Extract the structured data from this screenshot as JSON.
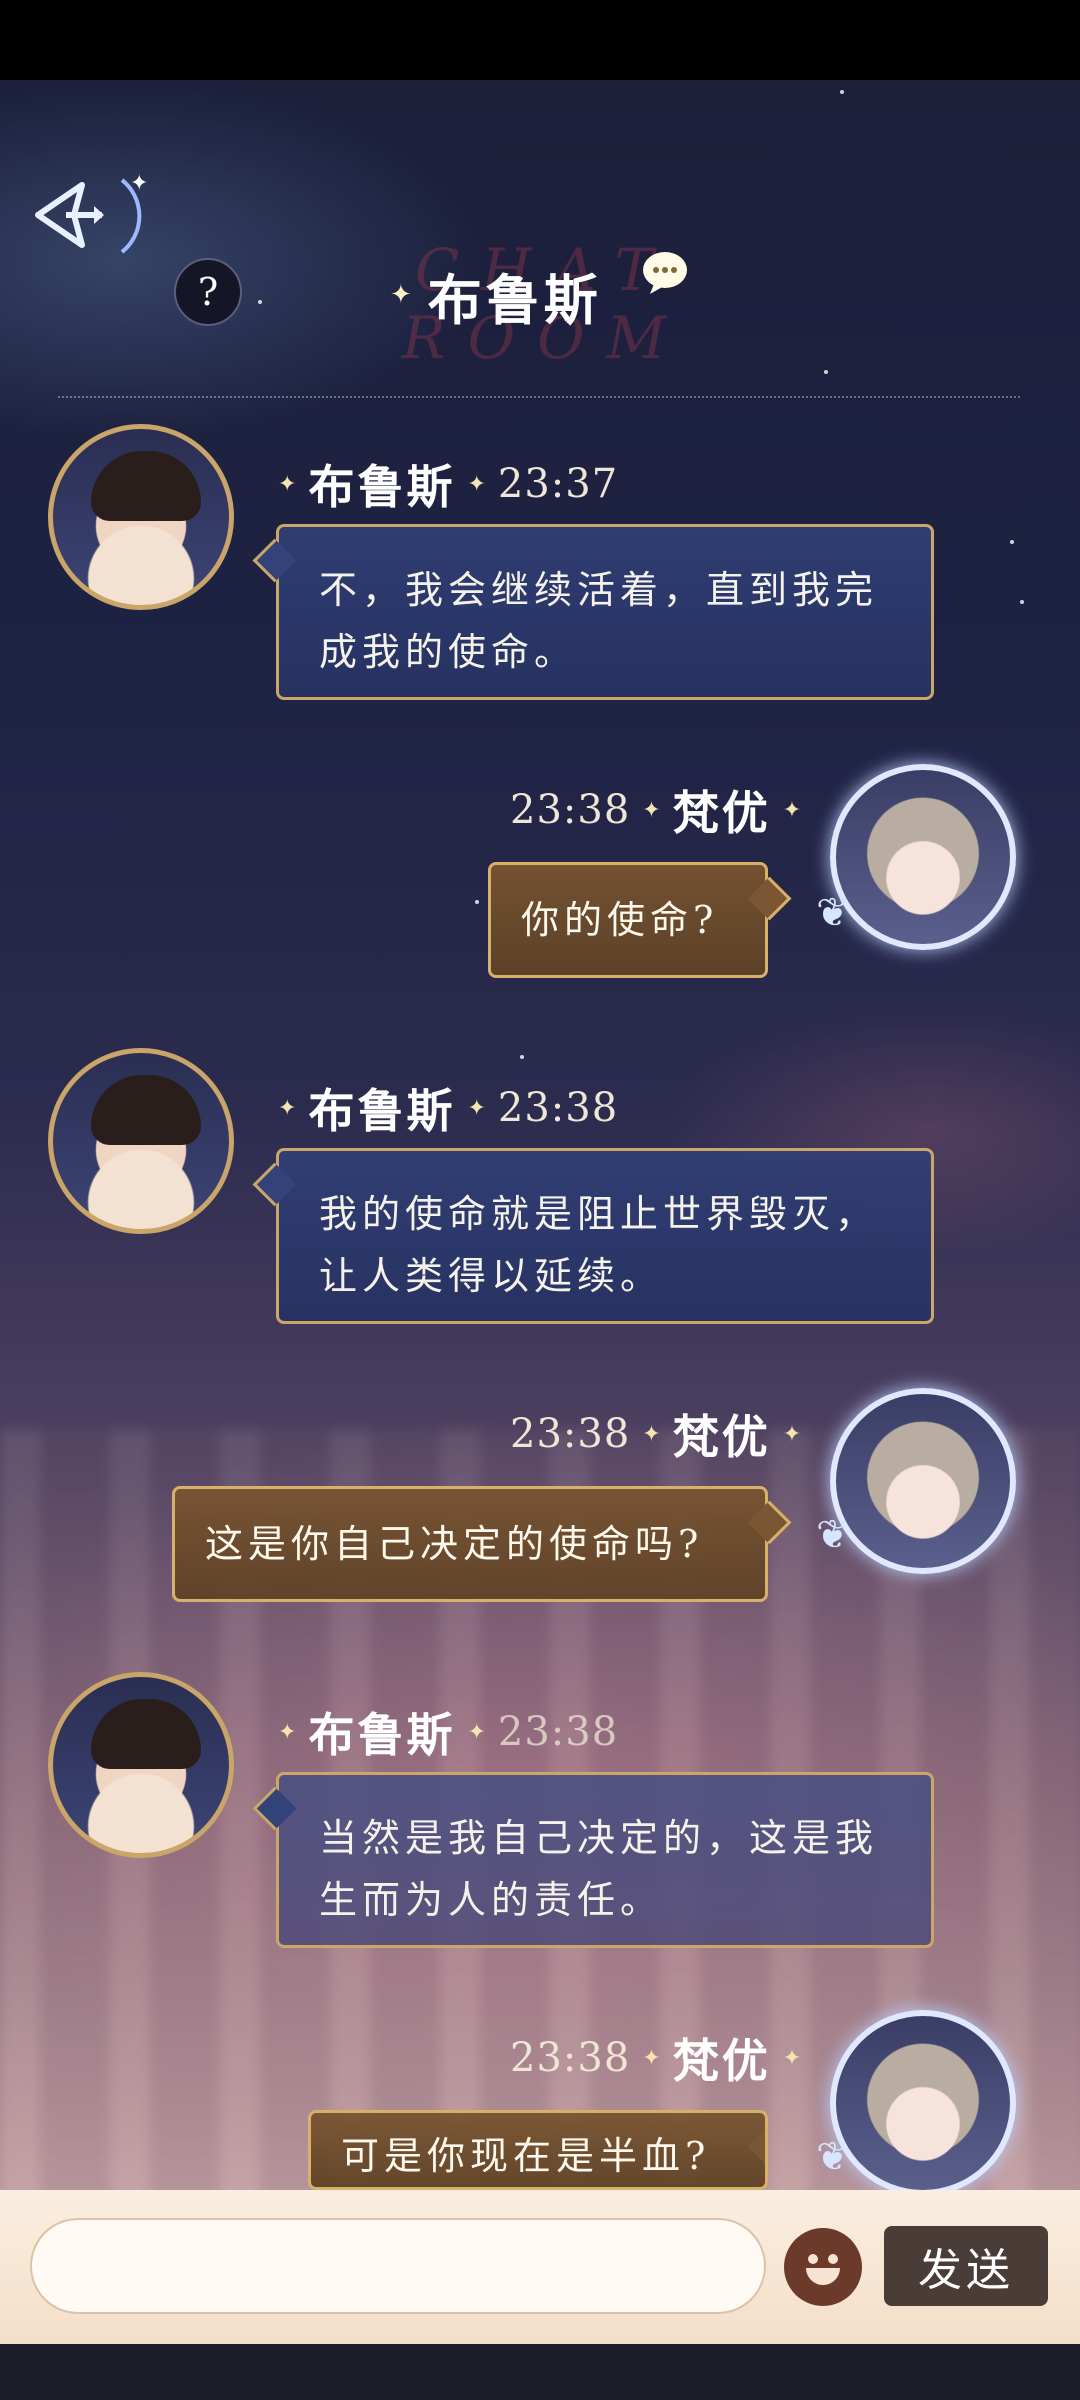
{
  "header": {
    "title": "布鲁斯",
    "watermark": "CHAT ROOM",
    "help_label": "?"
  },
  "messages": [
    {
      "side": "left",
      "sender": "布鲁斯",
      "time": "23:37",
      "text": "不，我会继续活着，直到我完成我的使命。"
    },
    {
      "side": "right",
      "sender": "梵优",
      "time": "23:38",
      "text": "你的使命?"
    },
    {
      "side": "left",
      "sender": "布鲁斯",
      "time": "23:38",
      "text": "我的使命就是阻止世界毁灭，让人类得以延续。"
    },
    {
      "side": "right",
      "sender": "梵优",
      "time": "23:38",
      "text": "这是你自己决定的使命吗?"
    },
    {
      "side": "left",
      "sender": "布鲁斯",
      "time": "23:38",
      "text": "当然是我自己决定的，这是我生而为人的责任。"
    },
    {
      "side": "right",
      "sender": "梵优",
      "time": "23:38",
      "text": "可是你现在是半血?"
    }
  ],
  "composer": {
    "input_value": "",
    "send_label": "发送"
  },
  "colors": {
    "accent_gold": "#caa768",
    "left_bubble": "#34427a",
    "right_bubble": "#7b5633"
  },
  "icons": [
    "back-arrow-icon",
    "chat-bubble-icon",
    "emoji-icon",
    "butterfly-icon"
  ]
}
